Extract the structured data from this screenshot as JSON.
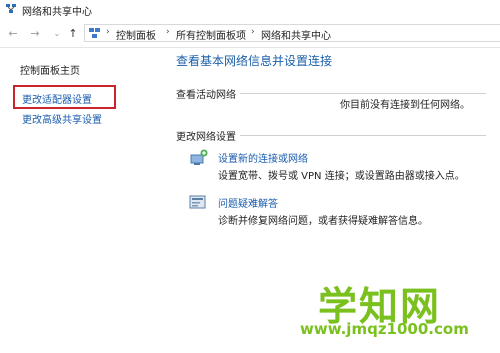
{
  "window": {
    "title": "网络和共享中心"
  },
  "nav": {
    "back_icon": "back-arrow-icon",
    "forward_icon": "forward-arrow-icon",
    "recent_icon": "chevron-down-icon",
    "up_icon": "up-arrow-icon",
    "breadcrumbs": [
      "控制面板",
      "所有控制面板项",
      "网络和共享中心"
    ],
    "separator": "›"
  },
  "sidebar": {
    "home": "控制面板主页",
    "items": [
      {
        "label": "更改适配器设置",
        "highlighted": true
      },
      {
        "label": "更改高级共享设置"
      }
    ]
  },
  "main": {
    "title": "查看基本网络信息并设置连接",
    "active_networks": {
      "label": "查看活动网络",
      "status": "你目前没有连接到任何网络。"
    },
    "change_settings": {
      "label": "更改网络设置",
      "tasks": [
        {
          "icon": "new-connection-icon",
          "link": "设置新的连接或网络",
          "desc": "设置宽带、拨号或 VPN 连接；或设置路由器或接入点。"
        },
        {
          "icon": "troubleshoot-icon",
          "link": "问题疑难解答",
          "desc": "诊断并修复网络问题，或者获得疑难解答信息。"
        }
      ]
    }
  },
  "watermark": {
    "name": "学知网",
    "url": "www.jmqz1000.com"
  },
  "colors": {
    "link": "#1a5cae",
    "title": "#1b5fa8",
    "highlight_box": "#c8262c",
    "watermark": "#7ac11f"
  }
}
